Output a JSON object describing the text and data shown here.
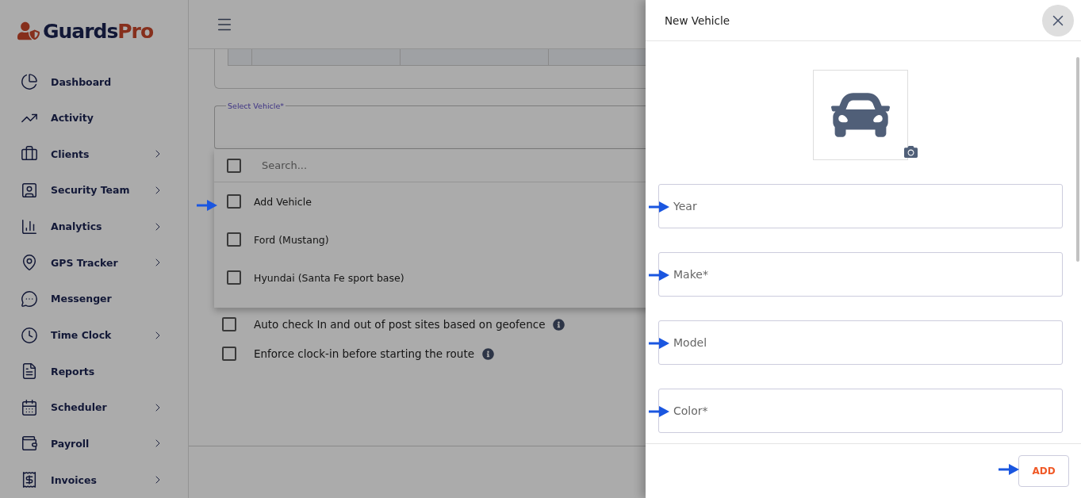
{
  "sidebar": {
    "logo": {
      "first": "Guards",
      "second": "Pro"
    },
    "items": [
      {
        "label": "Dashboard",
        "has_children": false
      },
      {
        "label": "Activity",
        "has_children": false
      },
      {
        "label": "Clients",
        "has_children": true
      },
      {
        "label": "Security Team",
        "has_children": true
      },
      {
        "label": "Analytics",
        "has_children": true
      },
      {
        "label": "GPS Tracker",
        "has_children": true
      },
      {
        "label": "Messenger",
        "has_children": false
      },
      {
        "label": "Time Clock",
        "has_children": true
      },
      {
        "label": "Reports",
        "has_children": false
      },
      {
        "label": "Scheduler",
        "has_children": true
      },
      {
        "label": "Payroll",
        "has_children": true
      },
      {
        "label": "Invoices",
        "has_children": true
      }
    ]
  },
  "vehicle_select": {
    "label": "Select Vehicle*"
  },
  "dropdown": {
    "search_placeholder": "Search...",
    "select_all_checked": false,
    "options": [
      {
        "label": "Add Vehicle",
        "checked": false
      },
      {
        "label": "Ford (Mustang)",
        "checked": false
      },
      {
        "label": "Hyundai (Santa Fe sport base)",
        "checked": false
      }
    ]
  },
  "settings": [
    {
      "label": "Auto check In and out of post sites based on geofence",
      "checked": false
    },
    {
      "label": "Enforce clock-in before starting the route",
      "checked": false
    }
  ],
  "drawer": {
    "title": "New Vehicle",
    "fields": [
      {
        "placeholder": "Year"
      },
      {
        "placeholder": "Make*"
      },
      {
        "placeholder": "Model"
      },
      {
        "placeholder": "Color*"
      }
    ],
    "add_button": "ADD"
  }
}
